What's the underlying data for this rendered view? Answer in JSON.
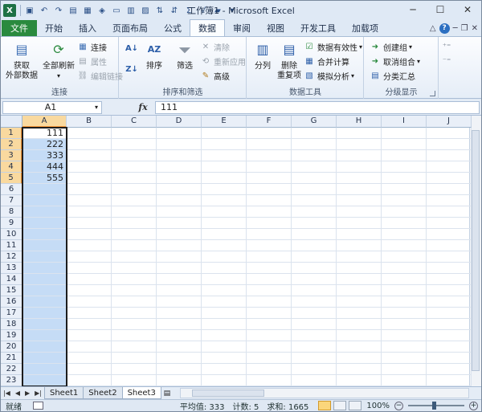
{
  "window": {
    "title": "工作簿1 - Microsoft Excel",
    "controls": [
      "─",
      "☐",
      "✕"
    ]
  },
  "tabs": [
    {
      "label": "文件"
    },
    {
      "label": "开始"
    },
    {
      "label": "插入"
    },
    {
      "label": "页面布局"
    },
    {
      "label": "公式"
    },
    {
      "label": "数据",
      "active": true
    },
    {
      "label": "审阅"
    },
    {
      "label": "视图"
    },
    {
      "label": "开发工具"
    },
    {
      "label": "加载项"
    }
  ],
  "ribbon": {
    "groups": {
      "connections": {
        "label": "连接",
        "get_external": "获取\n外部数据",
        "refresh_all": "全部刷新",
        "connections": "连接",
        "properties": "属性",
        "edit_links": "编辑链接"
      },
      "sort_filter": {
        "label": "排序和筛选",
        "sort": "排序",
        "filter": "筛选",
        "clear": "清除",
        "reapply": "重新应用",
        "advanced": "高级"
      },
      "data_tools": {
        "label": "数据工具",
        "text_to_columns": "分列",
        "remove_duplicates": "删除\n重复项",
        "data_validation": "数据有效性",
        "consolidate": "合并计算",
        "what_if": "模拟分析"
      },
      "outline": {
        "label": "分级显示",
        "group": "创建组",
        "ungroup": "取消组合",
        "subtotal": "分类汇总"
      }
    }
  },
  "formula_bar": {
    "name_box": "A1",
    "fx": "fx",
    "value": "111"
  },
  "grid": {
    "columns": [
      "A",
      "B",
      "C",
      "D",
      "E",
      "F",
      "G",
      "H",
      "I",
      "J"
    ],
    "rows": [
      "1",
      "2",
      "3",
      "4",
      "5",
      "6",
      "7",
      "8",
      "9",
      "10",
      "11",
      "12",
      "13",
      "14",
      "15",
      "16",
      "17",
      "18",
      "19",
      "20",
      "21",
      "22",
      "23"
    ],
    "selected_column": "A",
    "values_col_a": [
      "111",
      "222",
      "333",
      "444",
      "555"
    ]
  },
  "sheets": [
    {
      "label": "Sheet1"
    },
    {
      "label": "Sheet2"
    },
    {
      "label": "Sheet3",
      "active": true
    }
  ],
  "status": {
    "mode": "就绪",
    "average": "平均值: 333",
    "count": "计数: 5",
    "sum": "求和: 1665",
    "zoom": "100%"
  }
}
